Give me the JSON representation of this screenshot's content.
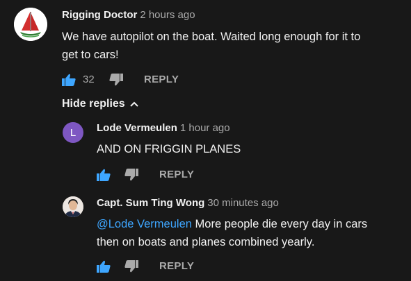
{
  "colors": {
    "background": "#181818",
    "text": "#f1f1f1",
    "muted": "#aaaaaa",
    "like_active": "#3ea6ff",
    "mention": "#3ea6ff",
    "avatar_l": "#7e57c2"
  },
  "main_comment": {
    "author": "Rigging Doctor",
    "time": "2 hours ago",
    "text_line1": "We have autopilot on the boat. Waited long enough for it to",
    "text_line2": "get to cars!",
    "likes": "32",
    "reply_label": "REPLY",
    "avatar_icon": "sailboat-logo-icon"
  },
  "hide_replies_label": "Hide replies",
  "replies": [
    {
      "author": "Lode Vermeulen",
      "time": "1 hour ago",
      "avatar_letter": "L",
      "text": "AND ON FRIGGIN PLANES",
      "reply_label": "REPLY"
    },
    {
      "author": "Capt. Sum Ting Wong",
      "time": "30 minutes ago",
      "avatar_icon": "person-photo-icon",
      "mention": "@Lode Vermeulen",
      "text_line1": " More people die every day in cars",
      "text_line2": "then on boats and planes combined yearly.",
      "reply_label": "REPLY"
    }
  ]
}
